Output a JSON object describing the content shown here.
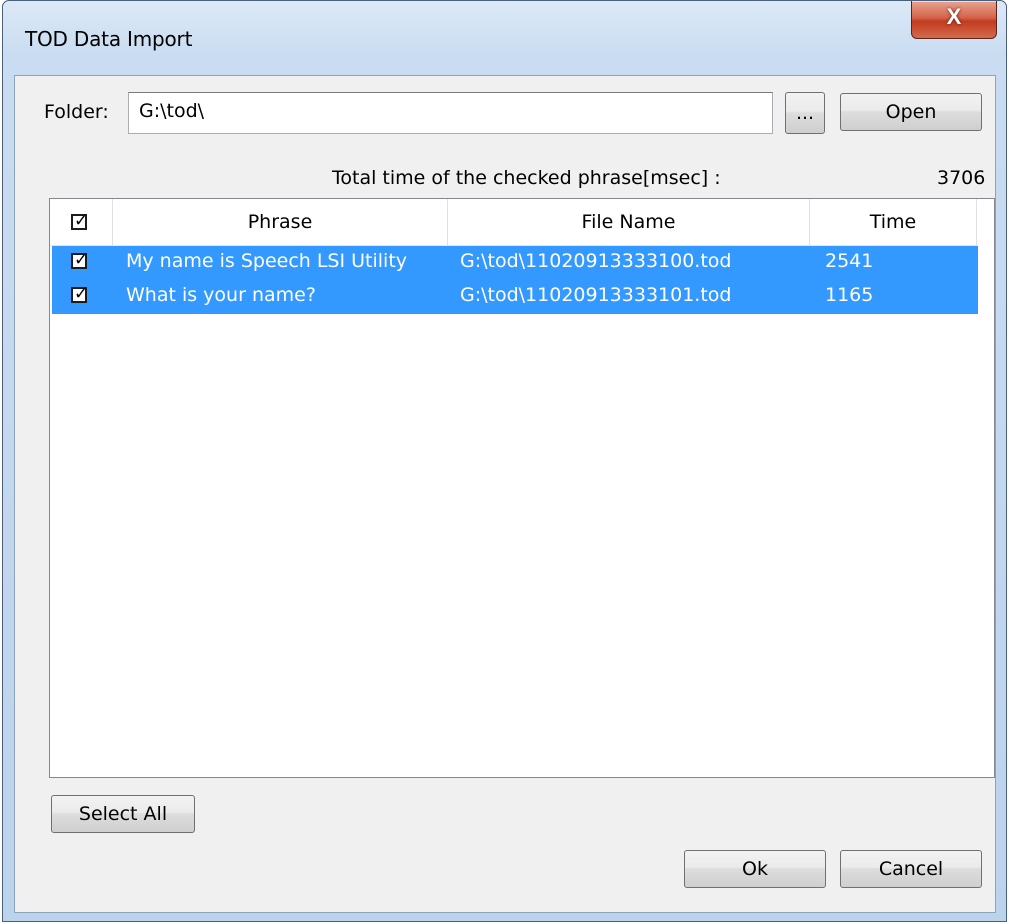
{
  "window": {
    "title": "TOD Data Import",
    "close_label": "X"
  },
  "folder": {
    "label": "Folder:",
    "value": "G:\\tod\\",
    "browse_label": "...",
    "open_label": "Open"
  },
  "total": {
    "label": "Total time of the checked phrase[msec] :",
    "value": "3706"
  },
  "list": {
    "header_checked": true,
    "columns": [
      "Phrase",
      "File Name",
      "Time"
    ],
    "rows": [
      {
        "checked": true,
        "phrase": "My name is Speech LSI Utility",
        "file": "G:\\tod\\11020913333100.tod",
        "time": "2541"
      },
      {
        "checked": true,
        "phrase": "What is your name?",
        "file": "G:\\tod\\11020913333101.tod",
        "time": "1165"
      }
    ],
    "selection_color": "#3399ff"
  },
  "buttons": {
    "select_all": "Select All",
    "ok": "Ok",
    "cancel": "Cancel"
  },
  "icons": {
    "close": "close-icon",
    "checkbox": "checkbox-icon"
  }
}
